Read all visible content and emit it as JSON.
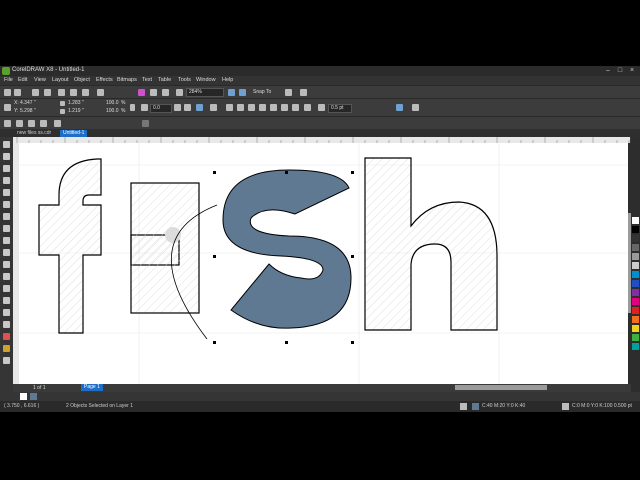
{
  "window": {
    "title": "CorelDRAW X8 - Untitled-1"
  },
  "menu": [
    "File",
    "Edit",
    "View",
    "Layout",
    "Object",
    "Effects",
    "Bitmaps",
    "Text",
    "Table",
    "Tools",
    "Window",
    "Help"
  ],
  "standard_toolbar": {
    "zoom": "284%",
    "snap_to": "Snap To"
  },
  "property_bar": {
    "x": "4.347 \"",
    "y": "5.298 \"",
    "width": "1.283 \"",
    "height": "1.219 \"",
    "scale_x": "100.0",
    "scale_y": "100.0",
    "percent": "%",
    "rotation": "0.0",
    "outline_width": "0.5 pt"
  },
  "tabs": [
    {
      "label": "new files ss.cdr",
      "active": false
    },
    {
      "label": "Untitled-1",
      "active": true
    }
  ],
  "canvas": {
    "word": "fish"
  },
  "pagebar": {
    "page_of": "1  of  1",
    "page_tab": "Page 1"
  },
  "status": {
    "coords": "( 3.750 , 6.616 )",
    "selection": "2 Objects Selected on Layer 1",
    "fill": "C:40 M:20 Y:0 K:40",
    "outline": "C:0 M:0 Y:0 K:100  0.500 pt"
  },
  "colors": {
    "selected_fill": "#5f7993",
    "swatches": [
      "#ffffff",
      "#000000",
      "#333333",
      "#666666",
      "#999999",
      "#cccccc",
      "#0090d0",
      "#2050c0",
      "#8030a0",
      "#e00080",
      "#e02020",
      "#f07020",
      "#f0d020",
      "#40b040",
      "#00a0a0"
    ]
  }
}
